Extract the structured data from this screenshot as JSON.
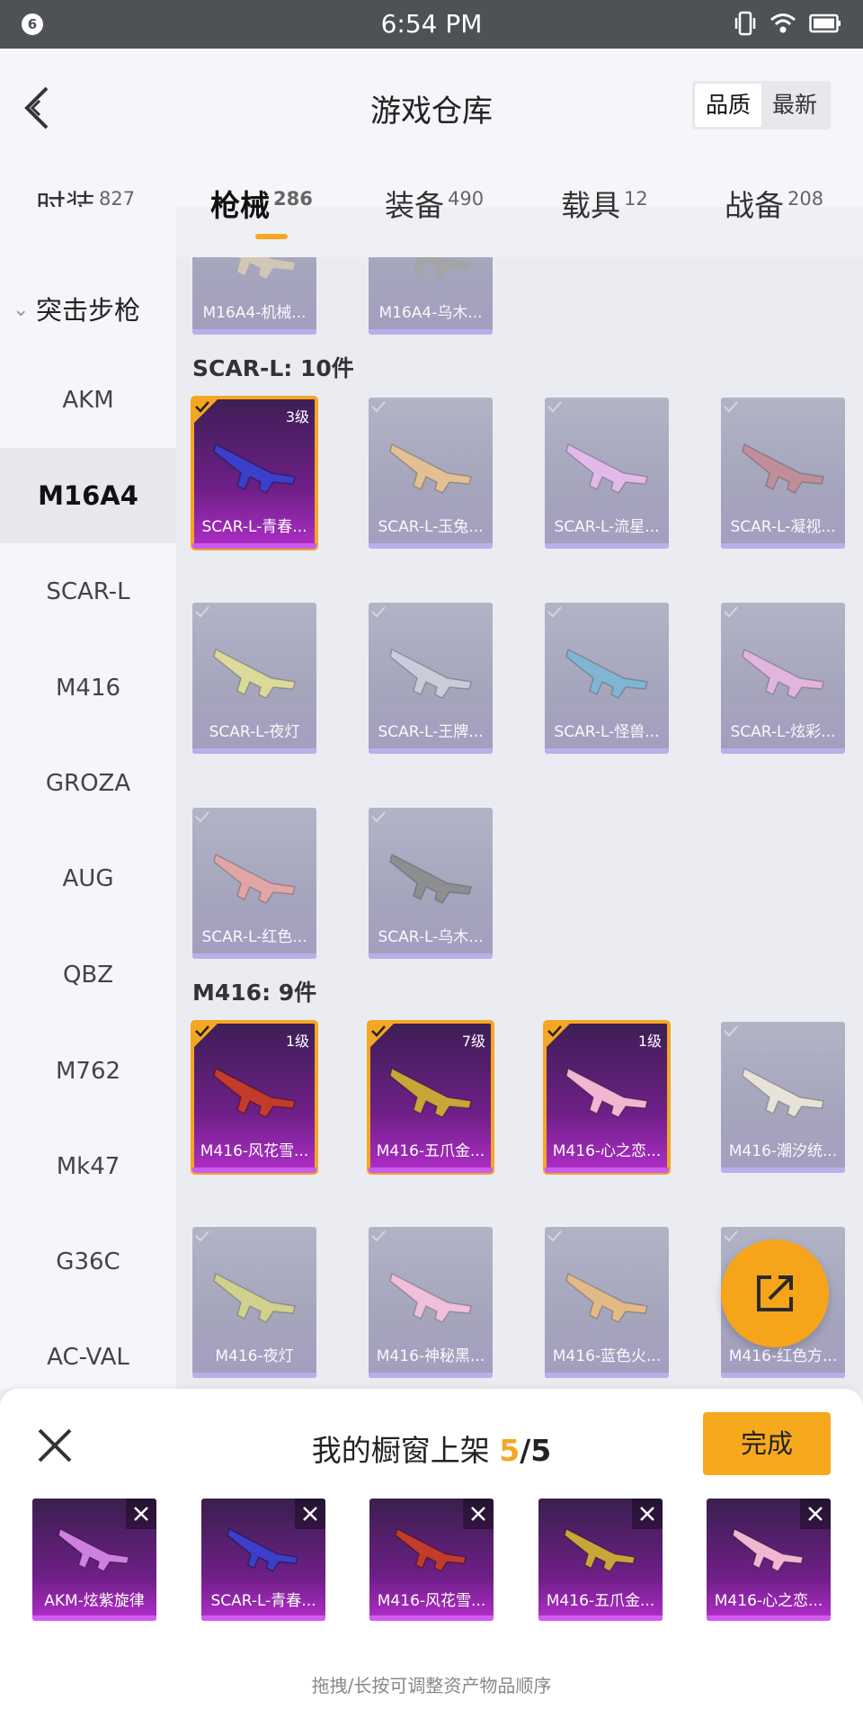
{
  "status_bar": {
    "notification_count": "6",
    "time": "6:54 PM"
  },
  "header": {
    "title": "游戏仓库",
    "sort_options": [
      "品质",
      "最新"
    ],
    "sort_active": "品质"
  },
  "tabs": [
    {
      "label": "时装",
      "count": "827"
    },
    {
      "label": "枪械",
      "count": "286",
      "active": true
    },
    {
      "label": "装备",
      "count": "490"
    },
    {
      "label": "载具",
      "count": "12"
    },
    {
      "label": "战备",
      "count": "208"
    }
  ],
  "sidebar": {
    "group": "突击步枪",
    "items": [
      "AKM",
      "M16A4",
      "SCAR-L",
      "M416",
      "GROZA",
      "AUG",
      "QBZ",
      "M762",
      "Mk47",
      "G36C",
      "AC-VAL"
    ],
    "active": "M16A4"
  },
  "sections": {
    "m16a4_partial": [
      {
        "name": "M16A4-机械...",
        "gun_color": "#c9b9a0"
      },
      {
        "name": "M16A4-乌木...",
        "gun_color": "#8a8a8a"
      }
    ],
    "scar": {
      "title": "SCAR-L: 10件",
      "items": [
        {
          "name": "SCAR-L-青春...",
          "level": "3级",
          "selected": true,
          "gun_color": "#3b3fc9"
        },
        {
          "name": "SCAR-L-玉兔...",
          "gun_color": "#e0b070"
        },
        {
          "name": "SCAR-L-流星...",
          "gun_color": "#e0a8e8"
        },
        {
          "name": "SCAR-L-凝视...",
          "gun_color": "#b06a7a"
        },
        {
          "name": "SCAR-L-夜灯",
          "gun_color": "#d8d47a"
        },
        {
          "name": "SCAR-L-王牌...",
          "gun_color": "#c0c0d0"
        },
        {
          "name": "SCAR-L-怪兽...",
          "gun_color": "#5aa0c8"
        },
        {
          "name": "SCAR-L-炫彩...",
          "gun_color": "#e0a0d8"
        },
        {
          "name": "SCAR-L-红色...",
          "gun_color": "#e08a8a"
        },
        {
          "name": "SCAR-L-乌木...",
          "gun_color": "#6a6a6a"
        }
      ]
    },
    "m416": {
      "title": "M416: 9件",
      "items": [
        {
          "name": "M416-风花雪...",
          "level": "1级",
          "selected": true,
          "gun_color": "#c23b2b"
        },
        {
          "name": "M416-五爪金...",
          "level": "7级",
          "selected": true,
          "gun_color": "#c8a63a"
        },
        {
          "name": "M416-心之恋...",
          "level": "1级",
          "selected": true,
          "gun_color": "#f2b6d2"
        },
        {
          "name": "M416-潮汐统...",
          "gun_color": "#e6e0d0"
        },
        {
          "name": "M416-夜灯",
          "gun_color": "#c8c86a"
        },
        {
          "name": "M416-神秘黑...",
          "gun_color": "#f0b0d0"
        },
        {
          "name": "M416-蓝色火...",
          "gun_color": "#e0a860"
        },
        {
          "name": "M416-红色方...",
          "gun_color": "#c07070"
        }
      ]
    }
  },
  "showcase": {
    "title_prefix": "我的橱窗上架",
    "current": "5",
    "separator": "/",
    "total": "5",
    "done_label": "完成",
    "slots": [
      {
        "name": "AKM-炫紫旋律",
        "gun_color": "#d080e0"
      },
      {
        "name": "SCAR-L-青春...",
        "gun_color": "#3b3fc9"
      },
      {
        "name": "M416-风花雪...",
        "gun_color": "#c23b2b"
      },
      {
        "name": "M416-五爪金...",
        "gun_color": "#c8a63a"
      },
      {
        "name": "M416-心之恋...",
        "gun_color": "#f2b6d2"
      }
    ],
    "hint": "拖拽/长按可调整资产物品顺序"
  },
  "colors": {
    "accent": "#f5a623",
    "selected_bg": "#6e1f87"
  }
}
